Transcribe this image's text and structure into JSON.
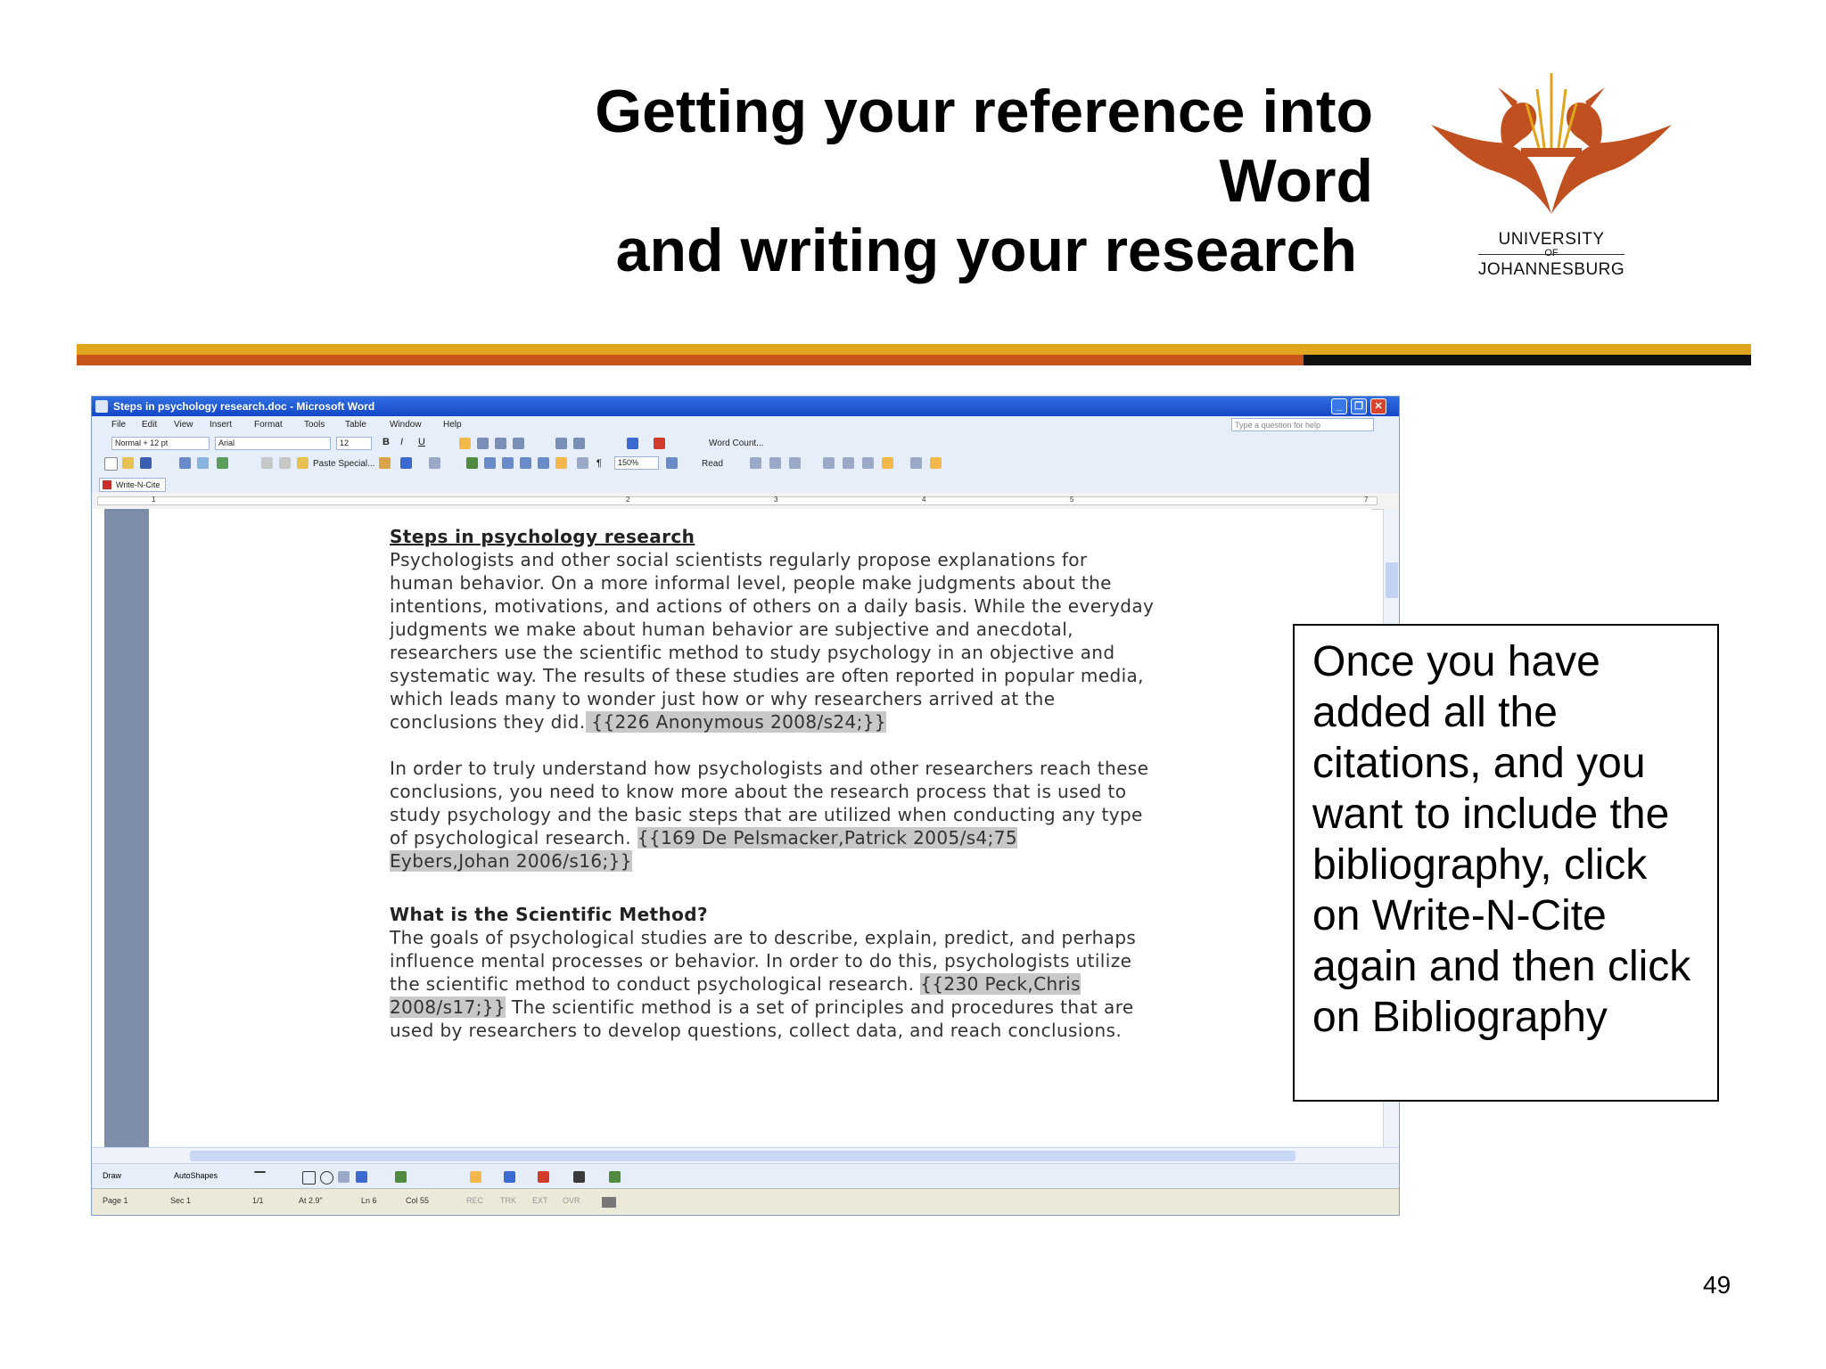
{
  "slide": {
    "title_line1": "Getting your reference into Word",
    "title_line2": "and writing your research",
    "page_number": "49",
    "logo": {
      "line1": "UNIVERSITY",
      "line2": "OF",
      "line3": "JOHANNESBURG",
      "color": "#c0501f"
    },
    "stripe_colors": {
      "gold": "#e0a51c",
      "orange": "#c8561c",
      "black": "#111111"
    },
    "callout": "Once you have added all the citations, and you want to include the bibliography, click on Write-N-Cite again and then click on Bibliography"
  },
  "word": {
    "window_title": "Steps in psychology research.doc - Microsoft Word",
    "menu": [
      "File",
      "Edit",
      "View",
      "Insert",
      "Format",
      "Tools",
      "Table",
      "Window",
      "Help"
    ],
    "help_placeholder": "Type a question for help",
    "style_value": "Normal + 12 pt",
    "font_value": "Arial",
    "size_value": "12",
    "word_count_label": "Word Count...",
    "paste_special_label": "Paste Special...",
    "zoom_value": "150%",
    "read_label": "Read",
    "addin_label": "Write-N-Cite",
    "ruler_numbers": [
      "1",
      "2",
      "3",
      "4",
      "5",
      "7"
    ],
    "draw_label": "Draw",
    "autoshapes_label": "AutoShapes",
    "status": {
      "page": "Page 1",
      "sec": "Sec 1",
      "pages": "1/1",
      "at": "At 2.9\"",
      "ln": "Ln 6",
      "col": "Col 55",
      "rec": "REC",
      "trk": "TRK",
      "ext": "EXT",
      "ovr": "OVR"
    },
    "document": {
      "heading1": "Steps in psychology research",
      "p1": [
        "Psychologists and other social scientists regularly propose explanations for",
        "human behavior. On a more informal level, people make judgments about the",
        "intentions, motivations, and actions of others on a daily basis. While the everyday",
        "judgments we make about human behavior are subjective and anecdotal,",
        "researchers use the scientific method to study psychology in an objective and",
        "systematic way. The results of these studies are often reported in popular media,",
        "which leads many to wonder just how or why researchers arrived at the"
      ],
      "p1_last": "conclusions they did.",
      "cite1": " {{226 Anonymous 2008/s24;}}",
      "p2": [
        "In order to truly understand how psychologists and other researchers reach these",
        "conclusions, you need to know more about the research process that is used to",
        "study psychology and the basic steps that are utilized when conducting any type"
      ],
      "p2_last": "of psychological research. ",
      "cite2a": "{{169 De Pelsmacker,Patrick 2005/s4;75",
      "cite2b": "Eybers,Johan 2006/s16;}}",
      "heading2": "What is the Scientific Method?",
      "p3": [
        "The goals of psychological studies are to describe, explain, predict, and perhaps",
        "influence mental processes or behavior. In order to do this, psychologists utilize"
      ],
      "p3_pre": "the scientific method to conduct psychological research. ",
      "cite3a": "{{230 Peck,Chris",
      "cite3b": "2008/s17;}}",
      "p3_post": " The scientific method is a set of principles and procedures that are",
      "p3_last": "used by researchers to develop questions, collect data, and reach conclusions."
    }
  }
}
